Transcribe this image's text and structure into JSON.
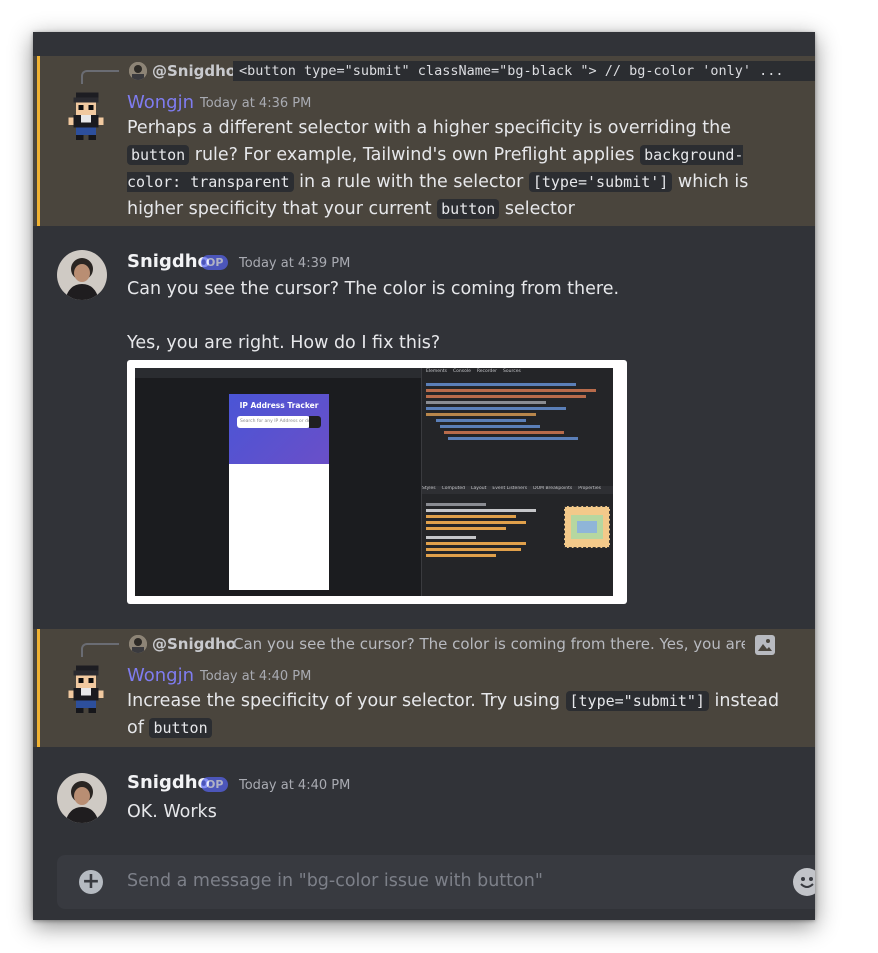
{
  "messages": [
    {
      "reply_to": {
        "author": "@Snigdho",
        "preview_code": "  <button type=\"submit\" className=\"bg-black \"> // bg-color 'only' ..."
      },
      "author": "Wongjn",
      "timestamp": "Today at 4:36 PM",
      "segments": [
        {
          "t": "Perhaps a different selector with a higher specificity is overriding the "
        },
        {
          "c": "button"
        },
        {
          "t": " rule? For example, Tailwind's own Preflight applies "
        },
        {
          "c": "background-color: transparent"
        },
        {
          "t": " in a rule with the selector "
        },
        {
          "c": "[type='submit']"
        },
        {
          "t": " which is higher specificity that your current "
        },
        {
          "c": "button"
        },
        {
          "t": " selector"
        }
      ]
    },
    {
      "author": "Snigdho",
      "badge": "OP",
      "timestamp": "Today at 4:39 PM",
      "line1": "Can you see the cursor? The color is coming from there.",
      "line2": "Yes, you are right. How do I fix this?",
      "attachment": {
        "app_title": "IP Address Tracker",
        "search_placeholder": "Search for any IP Address or domain",
        "devtools_tabs": [
          "Elements",
          "Console",
          "Recorder",
          "Sources"
        ],
        "styles_tabs": [
          "Styles",
          "Computed",
          "Layout",
          "Event Listeners",
          "DOM Breakpoints",
          "Properties"
        ]
      }
    },
    {
      "reply_to": {
        "author": "@Snigdho",
        "preview_text": "Can you see the cursor? The color is coming from there. Yes, you are r"
      },
      "author": "Wongjn",
      "timestamp": "Today at 4:40 PM",
      "segments": [
        {
          "t": "Increase the specificity of your selector. Try using "
        },
        {
          "c": "[type=\"submit\"]"
        },
        {
          "t": " instead of "
        },
        {
          "c": "button"
        }
      ]
    },
    {
      "author": "Snigdho",
      "badge": "OP",
      "timestamp": "Today at 4:40 PM",
      "text": "OK. Works"
    }
  ],
  "composer": {
    "placeholder": "Send a message in \"bg-color issue with button\""
  },
  "colors": {
    "highlight": "#4a453d",
    "accent": "#f0b232",
    "blurple": "#7f7cf0",
    "background": "#313338"
  }
}
